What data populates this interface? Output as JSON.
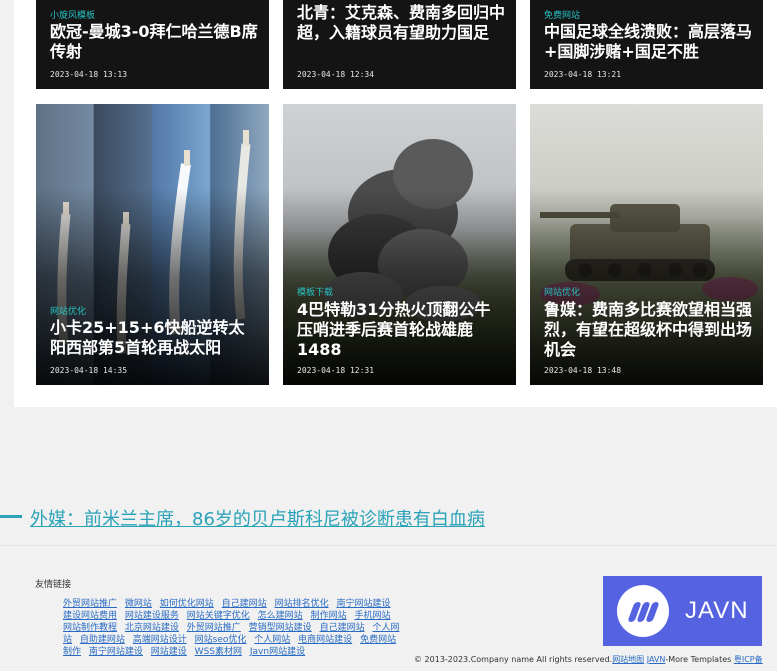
{
  "cards": [
    {
      "tag": "小旋风模板",
      "title": "欧冠-曼城3-0拜仁哈兰德B席传射",
      "date": "2023-04-18 13:13"
    },
    {
      "tag": "",
      "title": "北青：艾克森、费南多回归中超，入籍球员有望助力国足",
      "date": "2023-04-18 12:34"
    },
    {
      "tag": "免费网站",
      "title": "中国足球全线溃败：高层落马+国脚涉赌+国足不胜",
      "date": "2023-04-18 13:21"
    },
    {
      "tag": "网站优化",
      "title": "小卡25+15+6快船逆转太阳西部第5首轮再战太阳",
      "date": "2023-04-18 14:35"
    },
    {
      "tag": "模板下载",
      "title": "4巴特勒31分热火顶翻公牛压哨进季后赛首轮战雄鹿1488",
      "date": "2023-04-18 12:31"
    },
    {
      "tag": "网站优化",
      "title": "鲁媒：费南多比赛欲望相当强烈，有望在超级杯中得到出场机会",
      "date": "2023-04-18 13:48"
    }
  ],
  "headline": "外媒：前米兰主席，86岁的贝卢斯科尼被诊断患有白血病",
  "friend_links_title": "友情链接",
  "friend_links": [
    "外贸网站推广",
    "微网站",
    "如何优化网站",
    "自己建网站",
    "网站排名优化",
    "南宁网站建设",
    "建设网站费用",
    "网站建设服务",
    "网站关键字优化",
    "怎么建网站",
    "制作网站",
    "手机网站",
    "网站制作教程",
    "北京网站建设",
    "外贸网站推广",
    "营销型网站建设",
    "自己建网站",
    "个人网站",
    "自助建网站",
    "高端网站设计",
    "网站seo优化",
    "个人网站",
    "电商网站建设",
    "免费网站制作",
    "南宁网站建设",
    "网站建设",
    "WSS素材网",
    "Javn网站建设"
  ],
  "logo_text": "JAVN",
  "copyright": {
    "prefix": "© 2013-2023.Company name All rights reserved.",
    "sitemap": "网站地图",
    "brand": "JAVN",
    "more": "-More Templates ",
    "icp": "粤ICP备"
  },
  "colors": {
    "accent": "#2aa3b8",
    "logo_bg": "#5563e0",
    "link": "#2a6cc4"
  }
}
